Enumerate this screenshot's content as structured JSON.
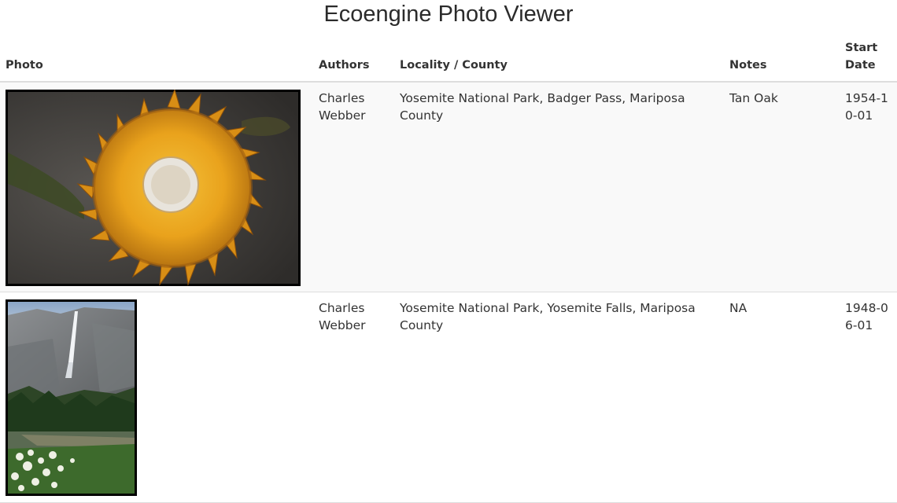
{
  "page": {
    "title": "Ecoengine Photo Viewer"
  },
  "columns": {
    "photo": "Photo",
    "authors": "Authors",
    "locality": "Locality / County",
    "notes": "Notes",
    "start_date": "Start Date"
  },
  "rows": [
    {
      "photo_subject": "oak-acorn-cross-section-photo",
      "authors": "Charles Webber",
      "locality": "Yosemite National Park, Badger Pass, Mariposa County",
      "notes": "Tan Oak",
      "start_date": "1954-10-01"
    },
    {
      "photo_subject": "yosemite-falls-landscape-photo",
      "authors": "Charles Webber",
      "locality": "Yosemite National Park, Yosemite Falls, Mariposa County",
      "notes": "NA",
      "start_date": "1948-06-01"
    }
  ],
  "colors": {
    "header_rule": "#dddddd",
    "stripe": "#f9f9f9",
    "text": "#333333"
  }
}
